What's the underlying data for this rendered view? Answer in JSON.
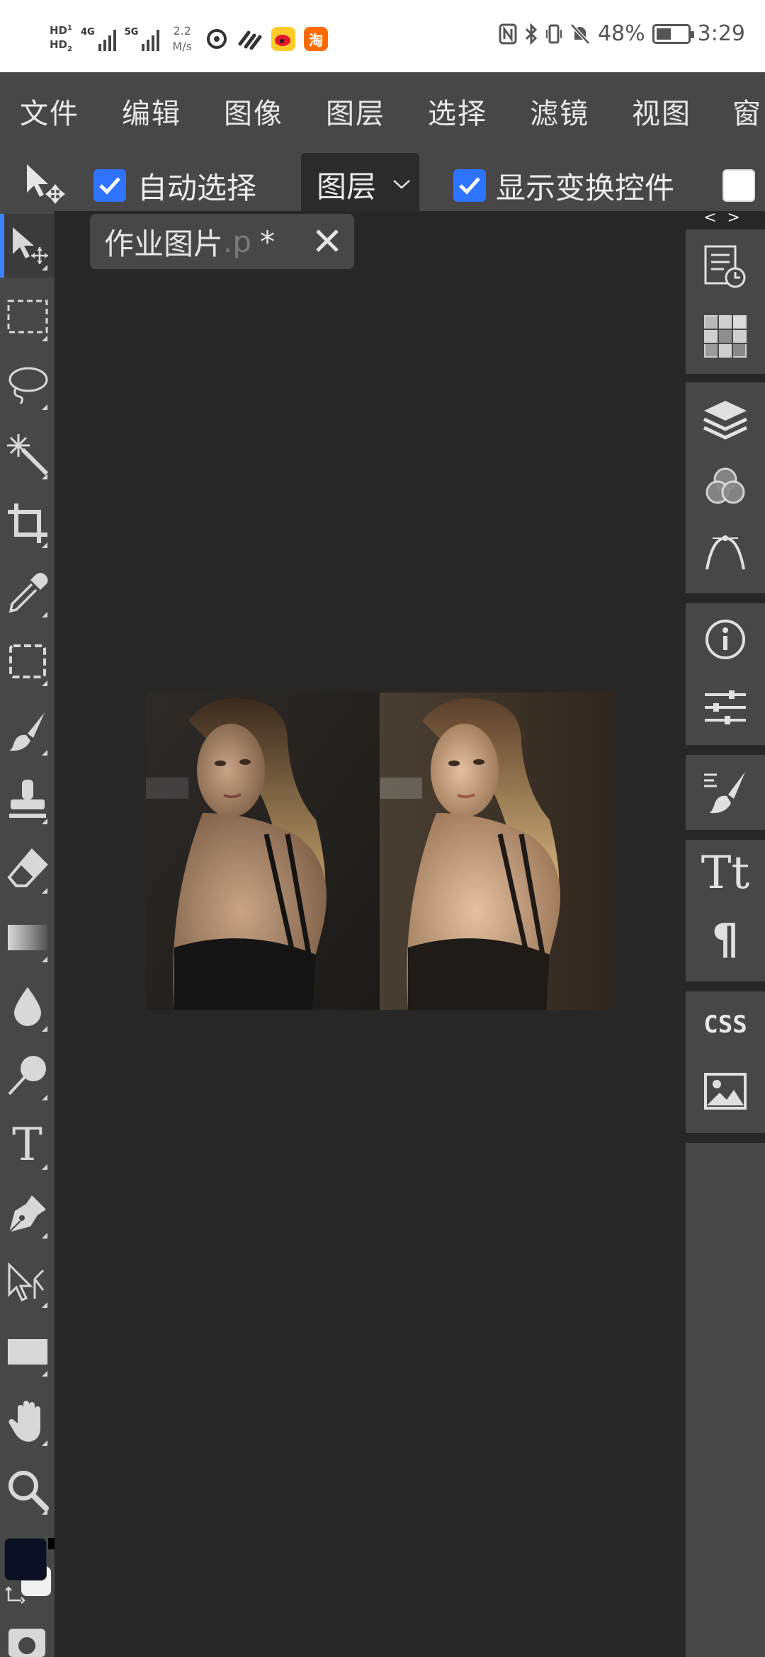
{
  "status_bar": {
    "hd1": "HD",
    "hd1_sub": "1",
    "hd2": "HD",
    "hd2_sub": "2",
    "net1": "4G",
    "net2": "5G",
    "speed_value": "2.2",
    "speed_unit": "M/s",
    "taobao_label": "淘",
    "battery_percent": "48%",
    "battery_level": 0.48,
    "time": "3:29"
  },
  "menu": {
    "items": [
      "文件",
      "编辑",
      "图像",
      "图层",
      "选择",
      "滤镜",
      "视图",
      "窗"
    ]
  },
  "options": {
    "auto_select_label": "自动选择",
    "auto_select_checked": true,
    "layer_dropdown": "图层",
    "show_transform_label": "显示变换控件",
    "show_transform_checked": true,
    "extra_checkbox_checked": false
  },
  "document": {
    "tab_name": "作业图片",
    "tab_ext": ".p",
    "modified_marker": "*"
  },
  "right_panel": {
    "collapse_label": "< >",
    "css_label": "CSS",
    "character_label": "Tt",
    "paragraph_label": "¶"
  },
  "tools": {
    "type_label": "T"
  },
  "colors": {
    "accent": "#2f74ff",
    "toolbar_bg": "#474747",
    "canvas_bg": "#272727",
    "foreground_color": "#0b1024",
    "background_color": "#f1f1f1"
  },
  "icons": [
    "move-tool-icon",
    "rect-select-icon",
    "lasso-icon",
    "magic-wand-icon",
    "crop-icon",
    "eyedropper-icon",
    "frame-select-icon",
    "brush-icon",
    "stamp-icon",
    "eraser-icon",
    "gradient-icon",
    "blur-drop-icon",
    "dodge-icon",
    "type-icon",
    "pen-icon",
    "path-select-icon",
    "rectangle-shape-icon",
    "hand-icon",
    "zoom-icon",
    "history-icon",
    "swatches-icon",
    "layers-icon",
    "channels-icon",
    "paths-icon",
    "info-icon",
    "adjustments-icon",
    "brush-settings-icon",
    "character-icon",
    "paragraph-icon",
    "css-icon",
    "image-icon"
  ]
}
